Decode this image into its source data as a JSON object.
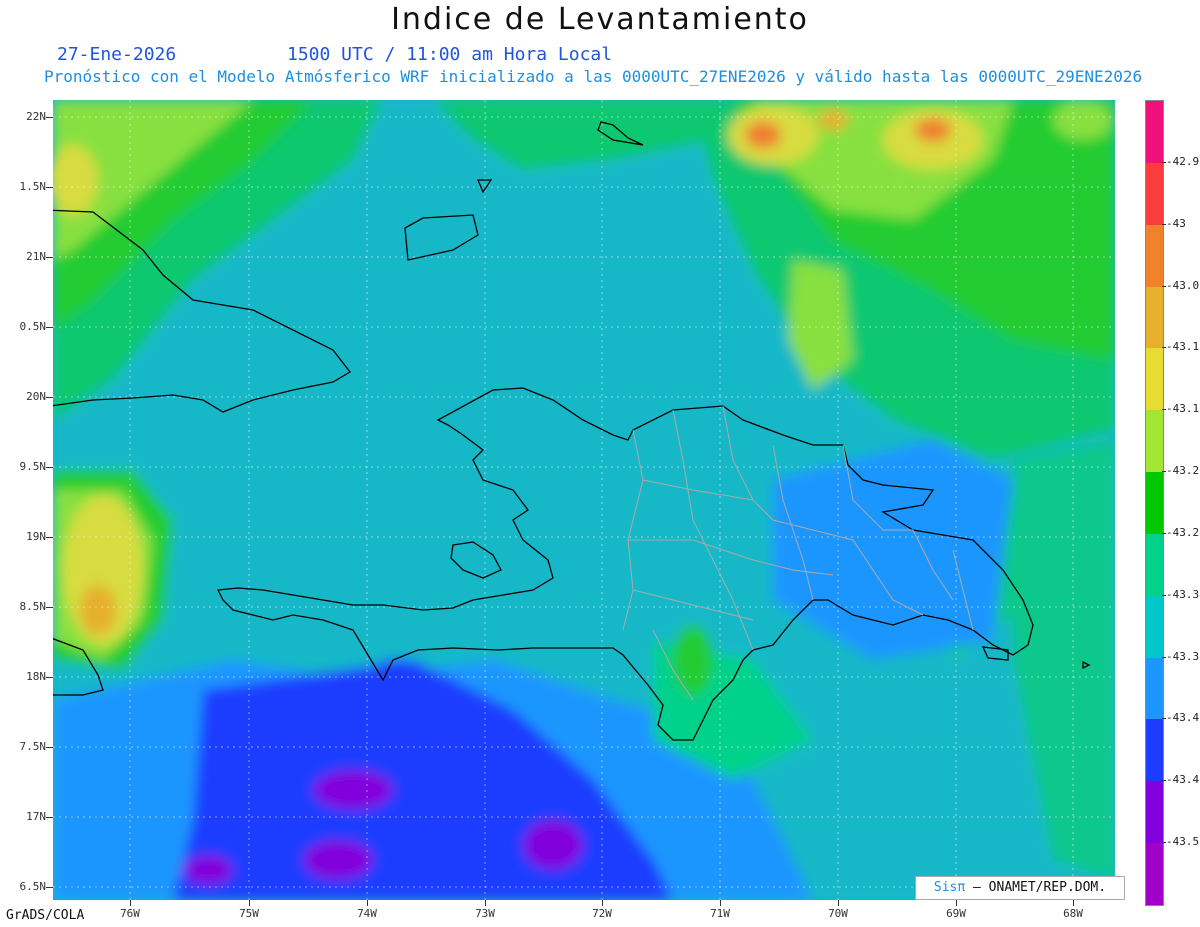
{
  "title": "Indice de Levantamiento",
  "date": "27-Ene-2026",
  "time": "1500 UTC / 11:00 am Hora Local",
  "subtitle": "Pronóstico con el Modelo Atmósferico WRF inicializado a las 0000UTC_27ENE2026 y válido hasta las  0000UTC_29ENE2026",
  "lat_labels": [
    "22N",
    "1.5N",
    "21N",
    "0.5N",
    "20N",
    "9.5N",
    "19N",
    "8.5N",
    "18N",
    "7.5N",
    "17N",
    "6.5N"
  ],
  "lon_labels": [
    "76W",
    "75W",
    "74W",
    "73W",
    "72W",
    "71W",
    "70W",
    "69W",
    "68W"
  ],
  "colorbar": {
    "labels": [
      "-42.9",
      "-43",
      "-43.0",
      "-43.1",
      "-43.1",
      "-43.2",
      "-43.2",
      "-43.3",
      "-43.3",
      "-43.4",
      "-43.4",
      "-43.5"
    ],
    "colors": [
      "#f0107c",
      "#fa3c3c",
      "#f0822c",
      "#e6af2d",
      "#e6dc32",
      "#a0e632",
      "#00c800",
      "#00d28c",
      "#00c8c8",
      "#1e96ff",
      "#1e3cff",
      "#8200dc",
      "#a000c8"
    ]
  },
  "footer_left": "GrADS/COLA",
  "credit": {
    "sis": "Sisπ",
    "rest": " – ONAMET/REP.DOM."
  }
}
